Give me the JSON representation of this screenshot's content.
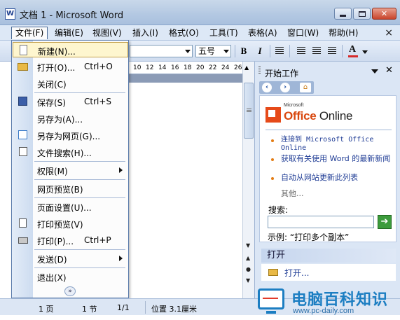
{
  "window": {
    "title": "文档 1 - Microsoft Word",
    "doc_close": "×"
  },
  "menubar": {
    "items": [
      "文件(F)",
      "编辑(E)",
      "视图(V)",
      "插入(I)",
      "格式(O)",
      "工具(T)",
      "表格(A)",
      "窗口(W)",
      "帮助(H)"
    ]
  },
  "toolbar": {
    "font_size": "五号",
    "bold": "B",
    "italic": "I",
    "font_color": "A"
  },
  "ruler": {
    "ticks": [
      "10",
      "12",
      "14",
      "16",
      "18",
      "20",
      "22",
      "24",
      "26"
    ]
  },
  "file_menu": {
    "items": [
      {
        "label": "新建(N)...",
        "shortcut": "",
        "icon": "new-doc-icon"
      },
      {
        "label": "打开(O)...",
        "shortcut": "Ctrl+O",
        "icon": "open-folder-icon"
      },
      {
        "label": "关闭(C)",
        "shortcut": "",
        "icon": ""
      },
      {
        "label": "保存(S)",
        "shortcut": "Ctrl+S",
        "icon": "save-disk-icon"
      },
      {
        "label": "另存为(A)...",
        "shortcut": "",
        "icon": ""
      },
      {
        "label": "另存为网页(G)...",
        "shortcut": "",
        "icon": "web-page-icon"
      },
      {
        "label": "文件搜索(H)...",
        "shortcut": "",
        "icon": "file-search-icon"
      },
      {
        "label": "权限(M)",
        "shortcut": "",
        "icon": ""
      },
      {
        "label": "网页预览(B)",
        "shortcut": "",
        "icon": ""
      },
      {
        "label": "页面设置(U)...",
        "shortcut": "",
        "icon": ""
      },
      {
        "label": "打印预览(V)",
        "shortcut": "",
        "icon": "print-preview-icon"
      },
      {
        "label": "打印(P)...",
        "shortcut": "Ctrl+P",
        "icon": "printer-icon"
      },
      {
        "label": "发送(D)",
        "shortcut": "",
        "icon": ""
      },
      {
        "label": "退出(X)",
        "shortcut": "",
        "icon": ""
      }
    ]
  },
  "taskpane": {
    "title": "开始工作",
    "logo_small": "Microsoft",
    "logo_office": "Office",
    "logo_online": " Online",
    "links": [
      "连接到 Microsoft Office Online",
      "获取有关使用 Word 的最新新闻",
      "自动从网站更新此列表"
    ],
    "other": "其他...",
    "search_label": "搜索:",
    "example": "示例: “打印多个副本”",
    "open_header": "打开",
    "open_link": "打开..."
  },
  "statusbar": {
    "page": "1 页",
    "section": "1 节",
    "pages": "1/1",
    "position": "位置 3.1厘米"
  },
  "watermark": {
    "title": "电脑百科知识",
    "url": "www.pc-daily.com"
  },
  "colors": {
    "title_gradient": "#b3c8e2",
    "menu_highlight": "#fef6cf",
    "accent_orange": "#e37d15",
    "brand_red": "#d9480f",
    "watermark_blue": "#1c7ec2"
  }
}
